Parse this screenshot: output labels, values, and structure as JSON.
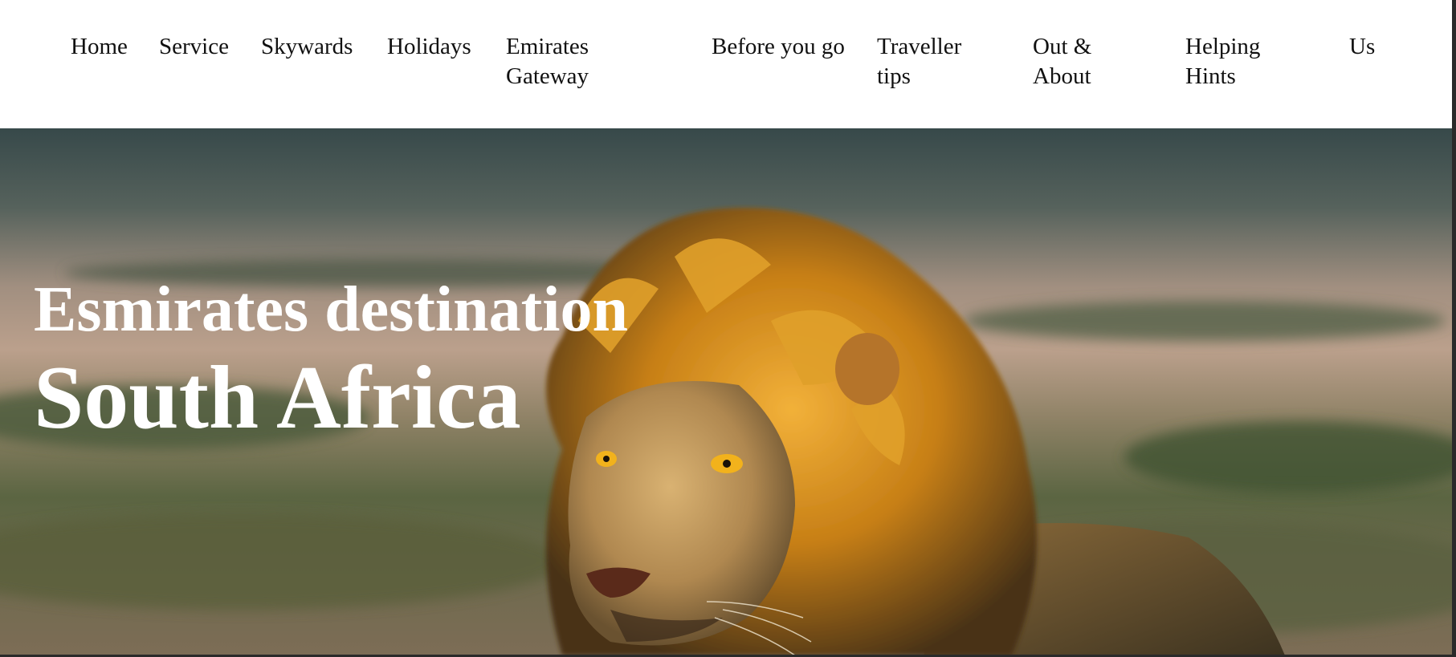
{
  "nav": {
    "items": [
      {
        "label": "Home"
      },
      {
        "label": "Service"
      },
      {
        "label": "Skywards"
      },
      {
        "label": "Holidays"
      },
      {
        "label": "Emirates Gateway"
      },
      {
        "label": "Before you go"
      },
      {
        "label": "Traveller tips"
      },
      {
        "label": "Out & About"
      },
      {
        "label": "Helping Hints"
      },
      {
        "label": "Us"
      }
    ]
  },
  "hero": {
    "heading_line1": "Esmirates destination",
    "heading_line2": "South Africa",
    "image": "lion-photo"
  },
  "colors": {
    "nav_background": "#ffffff",
    "nav_text": "#111111",
    "hero_text": "#ffffff",
    "lion_mane": "#c8861c",
    "sky": "#5b6660"
  }
}
